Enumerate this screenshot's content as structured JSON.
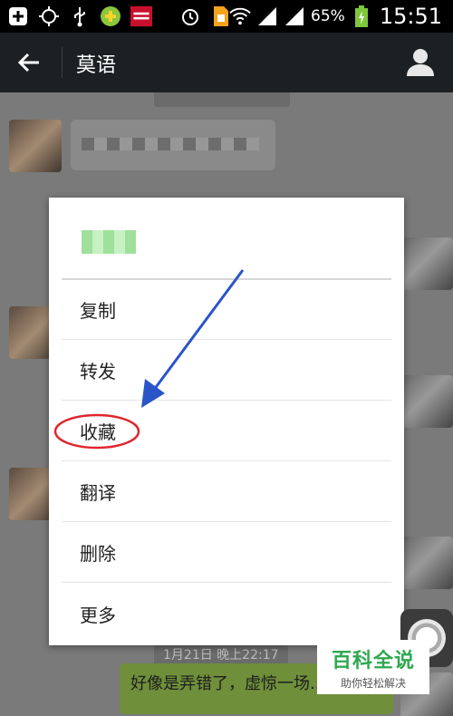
{
  "status_bar": {
    "icons": [
      "add-box-icon",
      "gps-icon",
      "usb-icon",
      "app-icon",
      "money-locker-icon",
      "alarm-icon",
      "sim-icon",
      "wifi-icon",
      "signal-icon",
      "signal-icon"
    ],
    "battery": "65%",
    "time": "15:51"
  },
  "title_bar": {
    "title": "莫语"
  },
  "chat": {
    "timestamp_bottom": "1月21日 晚上22:17",
    "last_message": "好像是弄错了，虚惊一场..."
  },
  "context_menu": {
    "items": [
      "复制",
      "转发",
      "收藏",
      "翻译",
      "删除",
      "更多"
    ]
  },
  "watermark": {
    "brand": "百科全说",
    "slogan": "助你轻松解决"
  },
  "colors": {
    "annotation_circle": "#e0262d",
    "annotation_arrow": "#2a55c8",
    "watermark_green": "#2fa84f"
  }
}
